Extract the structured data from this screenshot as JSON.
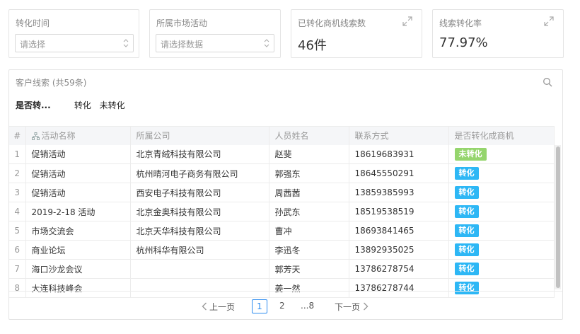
{
  "filters": {
    "time": {
      "label": "转化时间",
      "placeholder": "请选择"
    },
    "activity": {
      "label": "所属市场活动",
      "placeholder": "请选择数据"
    }
  },
  "metrics": {
    "converted": {
      "label": "已转化商机线索数",
      "value": "46件"
    },
    "rate": {
      "label": "线索转化率",
      "value": "77.97%"
    }
  },
  "panel": {
    "title": "客户线索 (共59条)",
    "filter_label": "是否转...",
    "filter_options": [
      "转化",
      "未转化"
    ]
  },
  "table": {
    "headers": {
      "idx": "#",
      "activity": "活动名称",
      "company": "所属公司",
      "person": "人员姓名",
      "contact": "联系方式",
      "converted": "是否转化成商机"
    },
    "rows": [
      {
        "idx": "1",
        "activity": "促销活动",
        "company": "北京青绒科技有限公司",
        "person": "赵斐",
        "contact": "18619683931",
        "status": "未转化",
        "status_type": "no"
      },
      {
        "idx": "2",
        "activity": "促销活动",
        "company": "杭州晴河电子商务有限公司",
        "person": "郭强东",
        "contact": "18645550291",
        "status": "转化",
        "status_type": "yes"
      },
      {
        "idx": "3",
        "activity": "促销活动",
        "company": "西安电子科技有限公司",
        "person": "周茜茜",
        "contact": "13859385993",
        "status": "转化",
        "status_type": "yes"
      },
      {
        "idx": "4",
        "activity": "2019-2-18 活动",
        "company": "北京金奥科技有限公司",
        "person": "孙武东",
        "contact": "18519538519",
        "status": "转化",
        "status_type": "yes"
      },
      {
        "idx": "5",
        "activity": "市场交流会",
        "company": "北京天华科技有限公司",
        "person": "曹冲",
        "contact": "18693841465",
        "status": "转化",
        "status_type": "yes"
      },
      {
        "idx": "6",
        "activity": "商业论坛",
        "company": "杭州科华有限公司",
        "person": "李迅冬",
        "contact": "13892935025",
        "status": "转化",
        "status_type": "yes"
      },
      {
        "idx": "7",
        "activity": "海口沙龙会议",
        "company": "",
        "person": "郭芳天",
        "contact": "13786278754",
        "status": "转化",
        "status_type": "yes"
      },
      {
        "idx": "8",
        "activity": "大连科技峰会",
        "company": "",
        "person": "姜一然",
        "contact": "13786278744",
        "status": "转化",
        "status_type": "yes"
      }
    ]
  },
  "pagination": {
    "prev": "上一页",
    "current": "1",
    "page2": "2",
    "ellipsis_last": "...8",
    "next": "下一页"
  },
  "colors": {
    "accent": "#2d8cf0",
    "tag_yes": "#2db7f5",
    "tag_no": "#95d56d"
  }
}
